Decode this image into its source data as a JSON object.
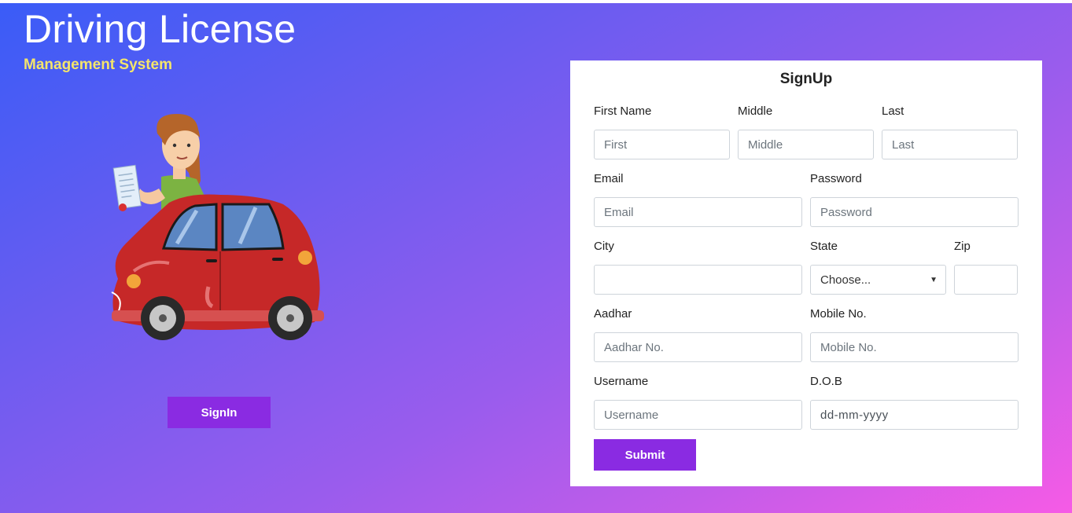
{
  "brand": {
    "title": "Driving License",
    "subtitle": "Management System"
  },
  "illustration": {
    "icon": "woman-with-red-car-illustration"
  },
  "signin": {
    "label": "SignIn"
  },
  "form": {
    "title": "SignUp",
    "first_name": {
      "label": "First Name",
      "placeholder": "First"
    },
    "middle": {
      "label": "Middle",
      "placeholder": "Middle"
    },
    "last": {
      "label": "Last",
      "placeholder": "Last"
    },
    "email": {
      "label": "Email",
      "placeholder": "Email"
    },
    "password": {
      "label": "Password",
      "placeholder": "Password"
    },
    "city": {
      "label": "City",
      "placeholder": ""
    },
    "state": {
      "label": "State",
      "selected": "Choose..."
    },
    "zip": {
      "label": "Zip",
      "placeholder": ""
    },
    "aadhar": {
      "label": "Aadhar",
      "placeholder": "Aadhar No."
    },
    "mobile": {
      "label": "Mobile No.",
      "placeholder": "Mobile No."
    },
    "username": {
      "label": "Username",
      "placeholder": "Username"
    },
    "dob": {
      "label": "D.O.B",
      "placeholder": "dd-mm-yyyy"
    },
    "submit_label": "Submit"
  },
  "colors": {
    "accent": "#8a2be2",
    "subtitle": "#f4e56b",
    "gradient_start": "#3a5cf7",
    "gradient_end": "#f65be6"
  }
}
